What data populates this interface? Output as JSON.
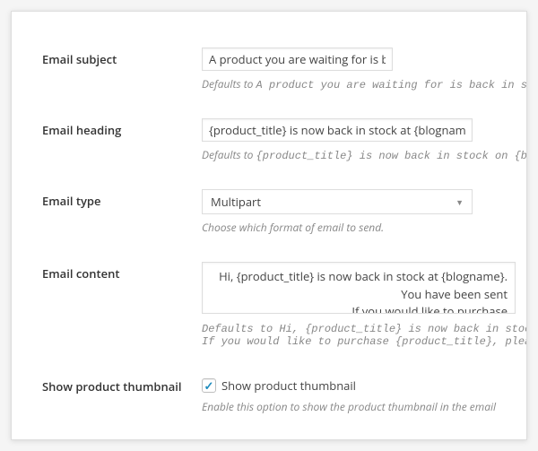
{
  "fields": {
    "subject": {
      "label": "Email subject",
      "value": "A product you are waiting for is back in stock",
      "hint_prefix": "Defaults to ",
      "hint_code": "A product you are waiting for is back in stock"
    },
    "heading": {
      "label": "Email heading",
      "value": "{product_title} is now back in stock at {blogname}",
      "hint_prefix": "Defaults to ",
      "hint_code": "{product_title} is now back in stock on {blogname}"
    },
    "type": {
      "label": "Email type",
      "value": "Multipart",
      "hint": "Choose which format of email to send."
    },
    "content": {
      "label": "Email content",
      "value": "Hi, {product_title} is now back in stock at {blogname}. You have been sent\nIf you would like to purchase",
      "hint_prefix": "Defaults to ",
      "hint_code_line1": "Hi, {product_title} is now back in stock on {blogname}. Yo",
      "hint_code_line2": "If you would like to purchase {product_title}, please visit the foll"
    },
    "thumbnail": {
      "label": "Show product thumbnail",
      "checkbox_label": "Show product thumbnail",
      "check": "✓",
      "hint": "Enable this option to show the product thumbnail in the email"
    }
  }
}
